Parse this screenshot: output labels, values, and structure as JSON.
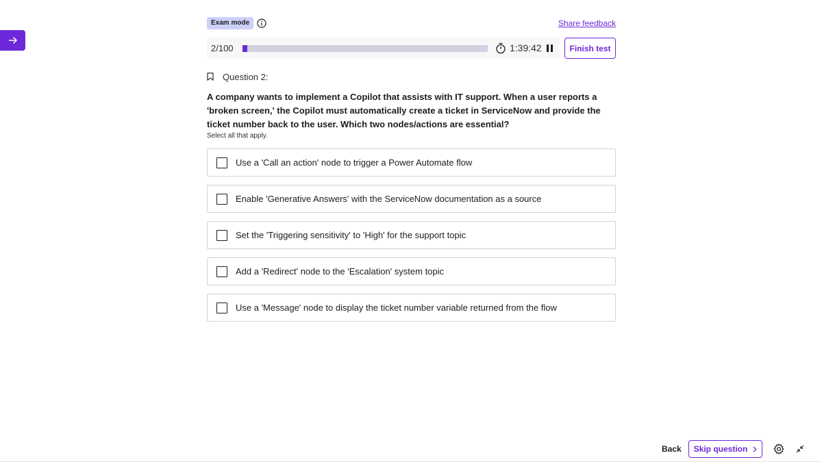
{
  "header": {
    "exam_badge": "Exam mode",
    "share_feedback": "Share feedback"
  },
  "progress": {
    "counter": "2/100",
    "current": 2,
    "total": 100,
    "timer": "1:39:42",
    "finish_label": "Finish test"
  },
  "question": {
    "label": "Question 2:",
    "text": "A company wants to implement a Copilot that assists with IT support. When a user reports a 'broken screen,' the Copilot must automatically create a ticket in ServiceNow and provide the ticket number back to the user. Which two nodes/actions are essential?",
    "hint": "Select all that apply.",
    "options": [
      {
        "label": "Use a 'Call an action' node to trigger a Power Automate flow"
      },
      {
        "label": "Enable 'Generative Answers' with the ServiceNow documentation as a source"
      },
      {
        "label": "Set the 'Triggering sensitivity' to 'High' for the support topic"
      },
      {
        "label": "Add a 'Redirect' node to the 'Escalation' system topic"
      },
      {
        "label": "Use a 'Message' node to display the ticket number variable returned from the flow"
      }
    ]
  },
  "footer": {
    "back_label": "Back",
    "skip_label": "Skip question"
  },
  "icons": {
    "side_toggle": "arrow-right-icon",
    "info": "info-icon",
    "timer": "stopwatch-icon",
    "pause": "pause-icon",
    "bookmark": "bookmark-icon",
    "skip": "chevron-right-icon",
    "settings": "gear-icon",
    "collapse": "collapse-icon"
  },
  "colors": {
    "accent": "#6d28d9",
    "badge_bg": "#cdd0f7",
    "track": "#d1d2e0"
  }
}
